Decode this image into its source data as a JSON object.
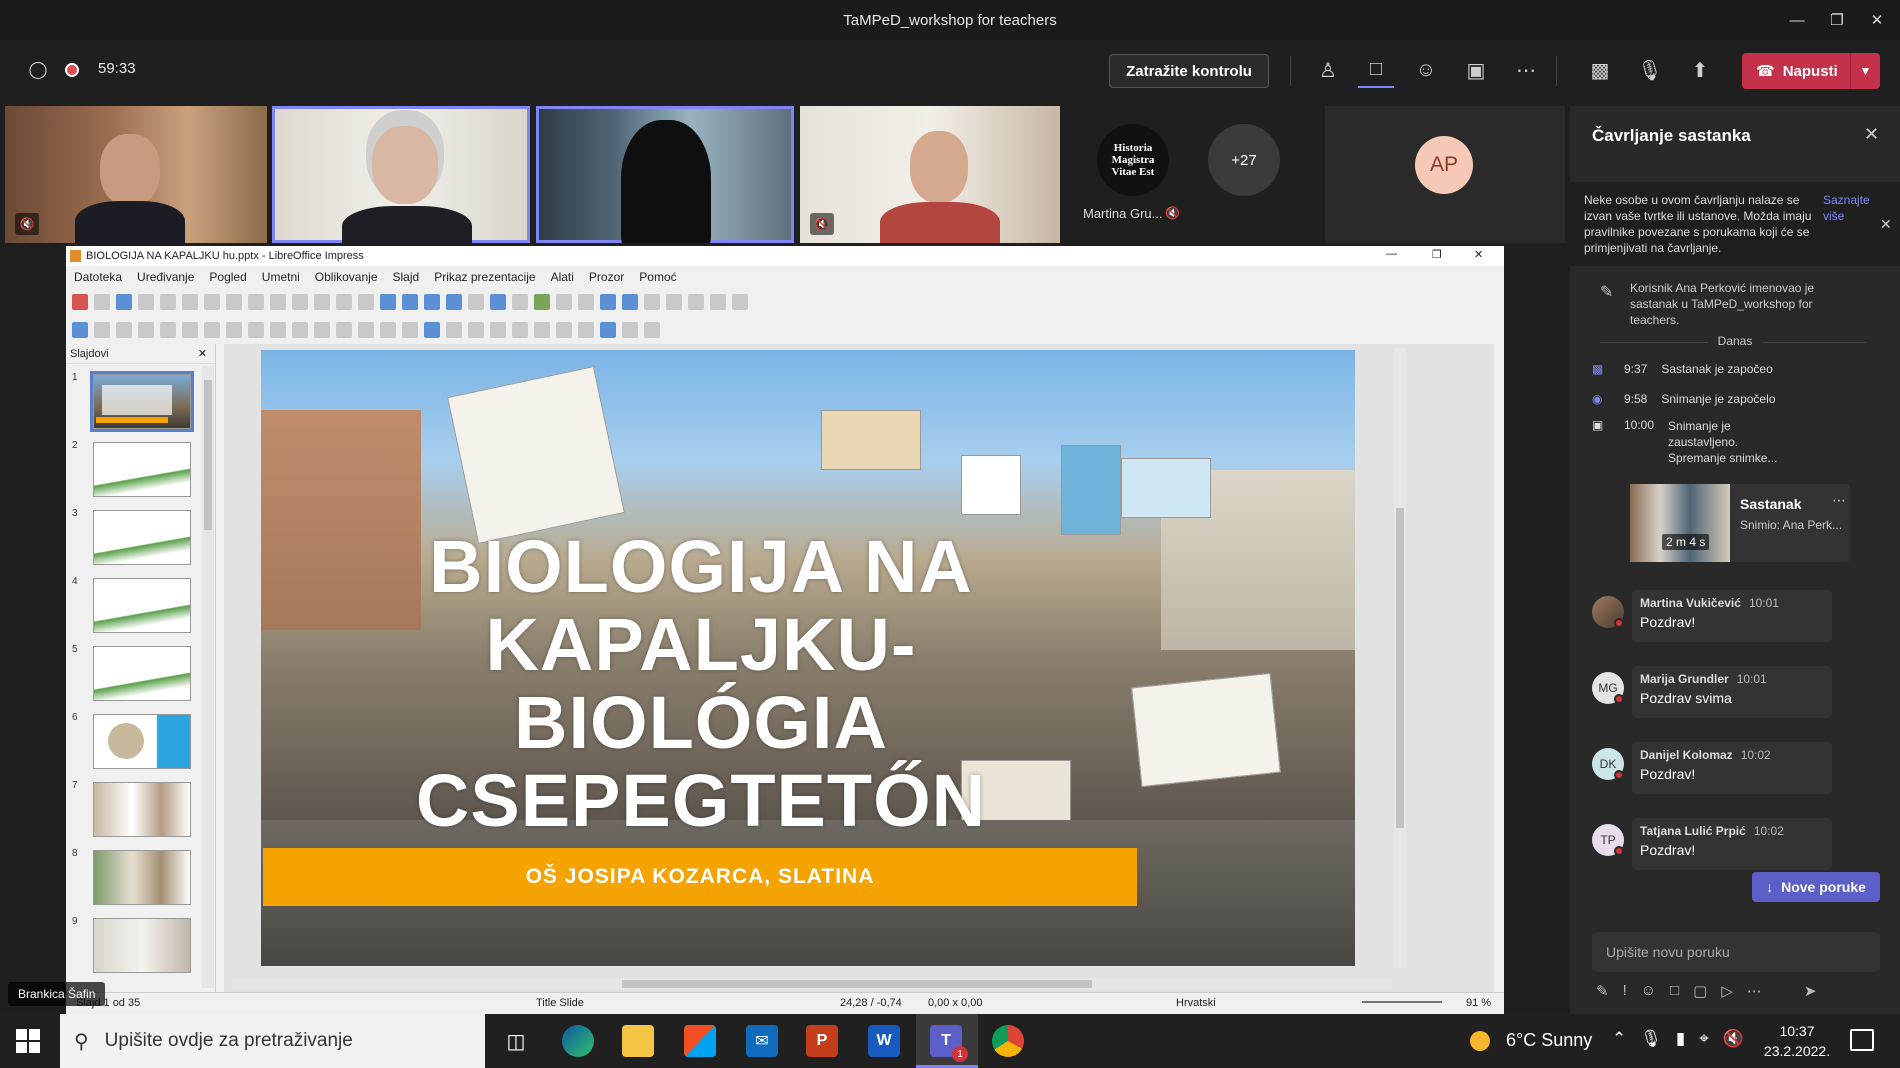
{
  "window": {
    "title": "TaMPeD_workshop for teachers"
  },
  "toolbar": {
    "timer": "59:33",
    "request_control": "Zatražite kontrolu",
    "leave": "Napusti"
  },
  "participants": [
    {
      "name": ""
    },
    {
      "name": ""
    },
    {
      "name": ""
    },
    {
      "name": ""
    },
    {
      "name": "Martina Gru...",
      "logo_text": "Historia Magistra Vitae Est"
    },
    {
      "overflow": "+27"
    },
    {
      "initials": "AP"
    }
  ],
  "presenter_label": "Brankica Šafin",
  "impress": {
    "title": "BIOLOGIJA NA KAPALJKU hu.pptx - LibreOffice Impress",
    "menu": [
      "Datoteka",
      "Uređivanje",
      "Pogled",
      "Umetni",
      "Oblikovanje",
      "Slajd",
      "Prikaz prezentacije",
      "Alati",
      "Prozor",
      "Pomoć"
    ],
    "slides_panel": "Slajdovi",
    "slide_numbers": [
      "1",
      "2",
      "3",
      "4",
      "5",
      "6",
      "7",
      "8",
      "9"
    ],
    "slide": {
      "title_lines": [
        "BIOLOGIJA NA",
        "KAPALJKU-",
        "BIOLÓGIA",
        "CSEPEGTETŐN"
      ],
      "subtitle": "OŠ JOSIPA KOZARCA, SLATINA"
    },
    "status": {
      "slide_count": "Slajd 1 od 35",
      "layout": "Title Slide",
      "position": "24,28 / -0,74",
      "size": "0,00 x 0,00",
      "language": "Hrvatski",
      "zoom": "91 %"
    }
  },
  "chat": {
    "title": "Čavrljanje sastanka",
    "notice": "Neke osobe u ovom čavrljanju nalaze se izvan vaše tvrtke ili ustanove. Možda imaju pravilnike povezane s porukama koji će se primjenjivati na čavrljanje.",
    "notice_link": "Saznajte više",
    "rename_event": "Korisnik Ana Perković imenovao je sastanak u TaMPeD_workshop for teachers.",
    "today": "Danas",
    "events": [
      {
        "time": "9:37",
        "text": "Sastanak je započeo"
      },
      {
        "time": "9:58",
        "text": "Snimanje je započelo"
      },
      {
        "time": "10:00",
        "text": "Snimanje je zaustavljeno. Spremanje snimke..."
      }
    ],
    "recording": {
      "title": "Sastanak",
      "subtitle": "Snimio: Ana Perk...",
      "duration": "2 m 4 s"
    },
    "messages": [
      {
        "name": "Martina Vukičević",
        "time": "10:01",
        "text": "Pozdrav!",
        "initials": ""
      },
      {
        "name": "Marija Grundler",
        "time": "10:01",
        "text": "Pozdrav svima",
        "initials": "MG"
      },
      {
        "name": "Danijel Kolomaz",
        "time": "10:02",
        "text": "Pozdrav!",
        "initials": "DK"
      },
      {
        "name": "Tatjana Lulić Prpić",
        "time": "10:02",
        "text": "Pozdrav!",
        "initials": "TP"
      }
    ],
    "new_messages": "Nove poruke",
    "input_placeholder": "Upišite novu poruku"
  },
  "taskbar": {
    "search_placeholder": "Upišite ovdje za pretraživanje",
    "weather": "6°C  Sunny",
    "time": "10:37",
    "date": "23.2.2022.",
    "teams_badge": "1"
  }
}
